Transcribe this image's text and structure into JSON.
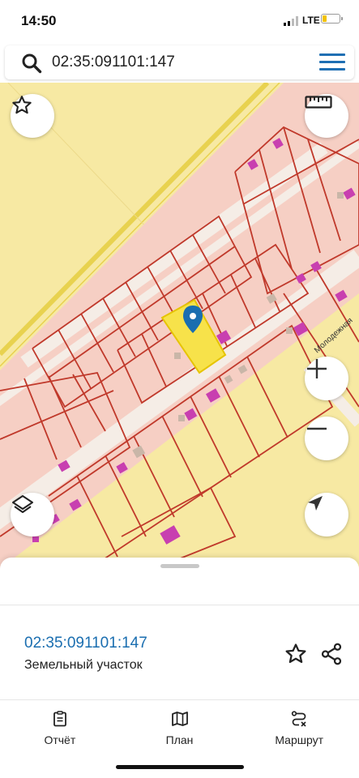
{
  "status_bar": {
    "time": "14:50",
    "network": "LTE"
  },
  "search": {
    "value": "02:35:091101:147",
    "icon": "search-icon",
    "menu_icon": "menu-icon"
  },
  "map": {
    "street_label": "Молодежная",
    "colors": {
      "background": "#f7e9a3",
      "parcel_fill": "#f6cfc4",
      "parcel_border": "#c0392b",
      "selected_parcel": "#f7e24a",
      "marker": "#1a6eb0",
      "building": "#c83fb0",
      "road": "#f5ede6"
    },
    "controls": {
      "favorite": "star-icon",
      "ruler": "ruler-icon",
      "zoom_in": "plus-icon",
      "zoom_out": "minus-icon",
      "layers": "layers-icon",
      "location": "navigation-arrow-icon"
    }
  },
  "sheet": {
    "cadastral_number": "02:35:091101:147",
    "parcel_type": "Земельный участок"
  },
  "tabs": [
    {
      "label": "Отчёт",
      "icon": "report-icon"
    },
    {
      "label": "План",
      "icon": "map-plan-icon"
    },
    {
      "label": "Маршрут",
      "icon": "route-icon"
    }
  ]
}
